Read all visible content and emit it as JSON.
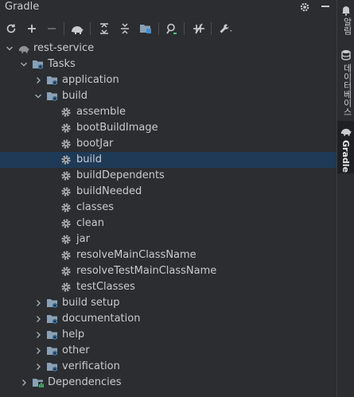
{
  "panel": {
    "title": "Gradle"
  },
  "toolbar": {
    "buttons": [
      {
        "name": "reload-icon",
        "glyph": "⟳"
      },
      {
        "name": "add-icon",
        "glyph": "+"
      },
      {
        "name": "remove-icon",
        "glyph": "−"
      },
      {
        "name": "execute-task-icon",
        "glyph": "elephant"
      },
      {
        "name": "expand-all-icon",
        "glyph": "expand"
      },
      {
        "name": "collapse-all-icon",
        "glyph": "collapse"
      },
      {
        "name": "dependency-analyzer-icon",
        "glyph": "folder"
      },
      {
        "name": "analyze-icon",
        "glyph": "search"
      },
      {
        "name": "toggle-offline-icon",
        "glyph": "offline"
      },
      {
        "name": "settings-wrench-icon",
        "glyph": "wrench"
      }
    ]
  },
  "tree": [
    {
      "label": "rest-service",
      "icon": "elephant",
      "arrow": "down",
      "level": 0
    },
    {
      "label": "Tasks",
      "icon": "folder-gear",
      "arrow": "down",
      "level": 1
    },
    {
      "label": "application",
      "icon": "folder-gear",
      "arrow": "right",
      "level": 2
    },
    {
      "label": "build",
      "icon": "folder-gear",
      "arrow": "down",
      "level": 2
    },
    {
      "label": "assemble",
      "icon": "gear",
      "arrow": "",
      "level": 3
    },
    {
      "label": "bootBuildImage",
      "icon": "gear",
      "arrow": "",
      "level": 3
    },
    {
      "label": "bootJar",
      "icon": "gear",
      "arrow": "",
      "level": 3
    },
    {
      "label": "build",
      "icon": "gear",
      "arrow": "",
      "level": 3,
      "selected": true
    },
    {
      "label": "buildDependents",
      "icon": "gear",
      "arrow": "",
      "level": 3
    },
    {
      "label": "buildNeeded",
      "icon": "gear",
      "arrow": "",
      "level": 3
    },
    {
      "label": "classes",
      "icon": "gear",
      "arrow": "",
      "level": 3
    },
    {
      "label": "clean",
      "icon": "gear",
      "arrow": "",
      "level": 3
    },
    {
      "label": "jar",
      "icon": "gear",
      "arrow": "",
      "level": 3
    },
    {
      "label": "resolveMainClassName",
      "icon": "gear",
      "arrow": "",
      "level": 3
    },
    {
      "label": "resolveTestMainClassName",
      "icon": "gear",
      "arrow": "",
      "level": 3
    },
    {
      "label": "testClasses",
      "icon": "gear",
      "arrow": "",
      "level": 3
    },
    {
      "label": "build setup",
      "icon": "folder-gear",
      "arrow": "right",
      "level": 2
    },
    {
      "label": "documentation",
      "icon": "folder-gear",
      "arrow": "right",
      "level": 2
    },
    {
      "label": "help",
      "icon": "folder-gear",
      "arrow": "right",
      "level": 2
    },
    {
      "label": "other",
      "icon": "folder-gear",
      "arrow": "right",
      "level": 2
    },
    {
      "label": "verification",
      "icon": "folder-gear",
      "arrow": "right",
      "level": 2
    },
    {
      "label": "Dependencies",
      "icon": "folder-chart",
      "arrow": "right",
      "level": 1
    }
  ],
  "right_strip": {
    "tabs": [
      {
        "label": "알림",
        "icon": "bell-icon",
        "active": false
      },
      {
        "label": "데이터베이스",
        "icon": "database-icon",
        "active": false
      },
      {
        "label": "Gradle",
        "icon": "elephant-icon",
        "active": true
      }
    ]
  },
  "colors": {
    "background": "#2b2d30",
    "selection": "#1e3a56",
    "folder": "#8aa1b5",
    "gear": "#a8abb0",
    "text": "#c8cbd0"
  }
}
